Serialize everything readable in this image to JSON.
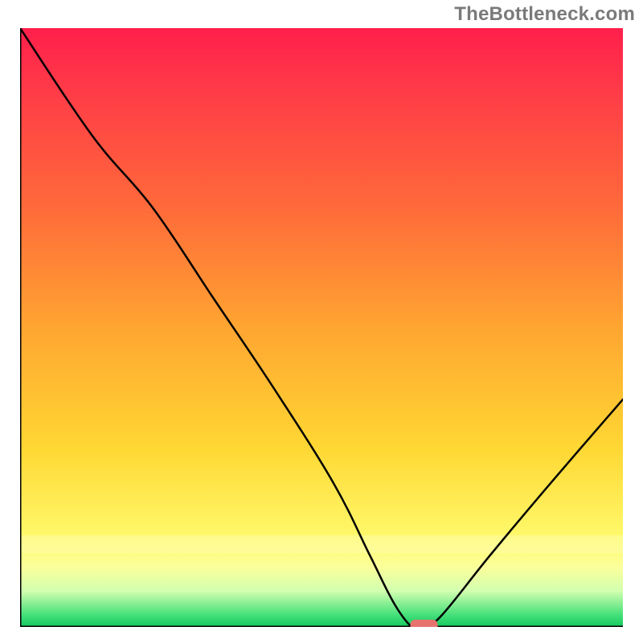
{
  "watermark": "TheBottleneck.com",
  "chart_data": {
    "type": "line",
    "title": "",
    "xlabel": "",
    "ylabel": "",
    "xlim": [
      0,
      100
    ],
    "ylim": [
      0,
      100
    ],
    "legend": false,
    "grid": false,
    "background": "red-yellow-green vertical gradient",
    "curve_description": "V-shaped bottleneck curve; descends steeply from top-left, reaches a flat minimum near x≈65, then rises to the right edge at roughly one-third height.",
    "minimum_marker": {
      "x": 67,
      "y": 0,
      "color": "#e7736f",
      "shape": "rounded-rect"
    },
    "series": [
      {
        "name": "bottleneck",
        "x": [
          0,
          12,
          22,
          32,
          42,
          52,
          58,
          62,
          65,
          67,
          70,
          78,
          88,
          100
        ],
        "values": [
          100,
          82,
          70,
          55,
          40,
          24,
          12,
          4,
          0,
          0,
          2,
          12,
          24,
          38
        ]
      }
    ]
  }
}
